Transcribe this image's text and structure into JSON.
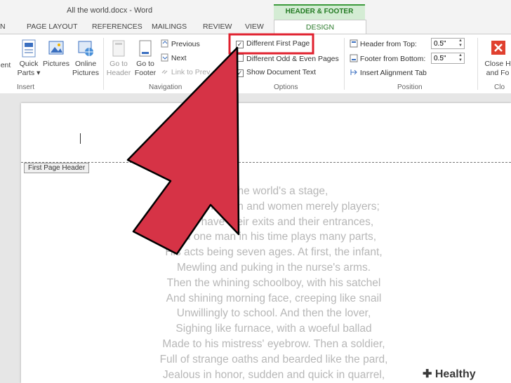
{
  "window": {
    "title": "All the world.docx - Word"
  },
  "contextual": {
    "label": "HEADER & FOOTER TOOLS"
  },
  "tabs": [
    "PAGE LAYOUT",
    "REFERENCES",
    "MAILINGS",
    "REVIEW",
    "VIEW",
    "DESIGN"
  ],
  "ribbon": {
    "insert": {
      "partial_label": "ent",
      "quick_parts": "Quick Parts",
      "pictures": "Pictures",
      "online_pictures": "Online Pictures",
      "group": "Insert"
    },
    "navigation": {
      "go_to_header": "Go to Header",
      "go_to_footer": "Go to Footer",
      "previous": "Previous",
      "next": "Next",
      "link_to_previous": "Link to Prev",
      "group": "Navigation"
    },
    "options": {
      "different_first_page": "Different First Page",
      "different_odd_even": "Different Odd & Even Pages",
      "show_document_text": "Show Document Text",
      "group": "Options",
      "different_first_page_checked": true,
      "show_document_text_checked": true
    },
    "position": {
      "header_from_top": "Header from Top:",
      "header_value": "0.5\"",
      "footer_from_bottom": "Footer from Bottom:",
      "footer_value": "0.5\"",
      "insert_alignment_tab": "Insert Alignment Tab",
      "group": "Position"
    },
    "close": {
      "label": "Close H and Fo",
      "group": "Clo"
    }
  },
  "document": {
    "header_tag": "First Page Header",
    "poem_lines": [
      "All the world's a stage,",
      "And all the men and women merely players;",
      "They have their exits and their entrances,",
      "And one man in his time plays many parts,",
      "His acts being seven ages. At first, the infant,",
      "Mewling and puking in the nurse's arms.",
      "Then the whining schoolboy, with his satchel",
      "And shining morning face, creeping like snail",
      "Unwillingly to school. And then the lover,",
      "Sighing like furnace, with a woeful ballad",
      "Made to his mistress' eyebrow. Then a soldier,",
      "Full of strange oaths and bearded like the pard,",
      "Jealous in honor, sudden and quick in quarrel,"
    ]
  },
  "watermark": "Healthy Living",
  "colors": {
    "accent_green": "#2b7a2b",
    "arrow_red": "#d63346",
    "highlight_box": "#e0202e"
  }
}
